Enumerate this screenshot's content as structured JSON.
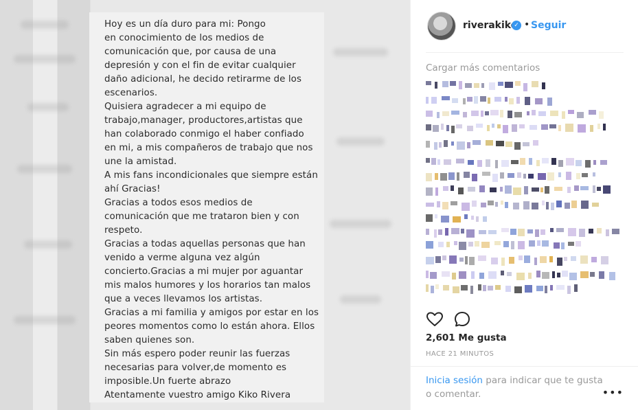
{
  "post": {
    "text_lines": [
      "Hoy es un día duro para mi: Pongo",
      "en conocimiento de los medios de",
      "comunicación que, por causa de una",
      "depresión y con el fin de evitar cualquier",
      "daño adicional, he decido retirarme de los",
      "escenarios.",
      "Quisiera agradecer a mi equipo de",
      "trabajo,manager, productores,artistas que",
      "han colaborado conmigo el haber confiado",
      "en mi, a mis compañeros de trabajo que nos",
      "une la amistad.",
      "A mis fans incondicionales que siempre están",
      "ahí Gracias!",
      "Gracias a todos esos medios de",
      "comunicación que me trataron bien y con",
      "respeto.",
      "Gracias a todas aquellas personas que han",
      "venido a verme alguna vez algún",
      "concierto.Gracias a mi mujer por aguantar",
      "mis malos humores y los horarios tan malos",
      "que a veces llevamos los artistas.",
      "Gracias a mi familia y amigos por estar en los",
      "peores momentos como lo están ahora. Ellos",
      "saben quienes son.",
      "Sin más espero poder reunir las fuerzas",
      "necesarias para volver,de momento es",
      "imposible.Un fuerte abrazo",
      "Atentamente vuestro amigo Kiko Rivera"
    ]
  },
  "header": {
    "username": "riverakiko",
    "verified_icon": "verified-badge-icon",
    "separator": "•",
    "follow_label": "Seguir"
  },
  "comments": {
    "load_more_label": "Cargar más comentarios"
  },
  "actions": {
    "like_icon": "heart-icon",
    "comment_icon": "comment-icon"
  },
  "stats": {
    "likes_label": "2,601 Me gusta",
    "time_label": "HACE 21 MINUTOS"
  },
  "footer": {
    "login_link": "Inicia sesión",
    "login_text": " para indicar que te gusta o comentar.",
    "more_icon": "more-options-icon",
    "more_glyph": "•••"
  },
  "colors": {
    "accent": "#3897f0",
    "text": "#262626",
    "muted": "#999999"
  }
}
